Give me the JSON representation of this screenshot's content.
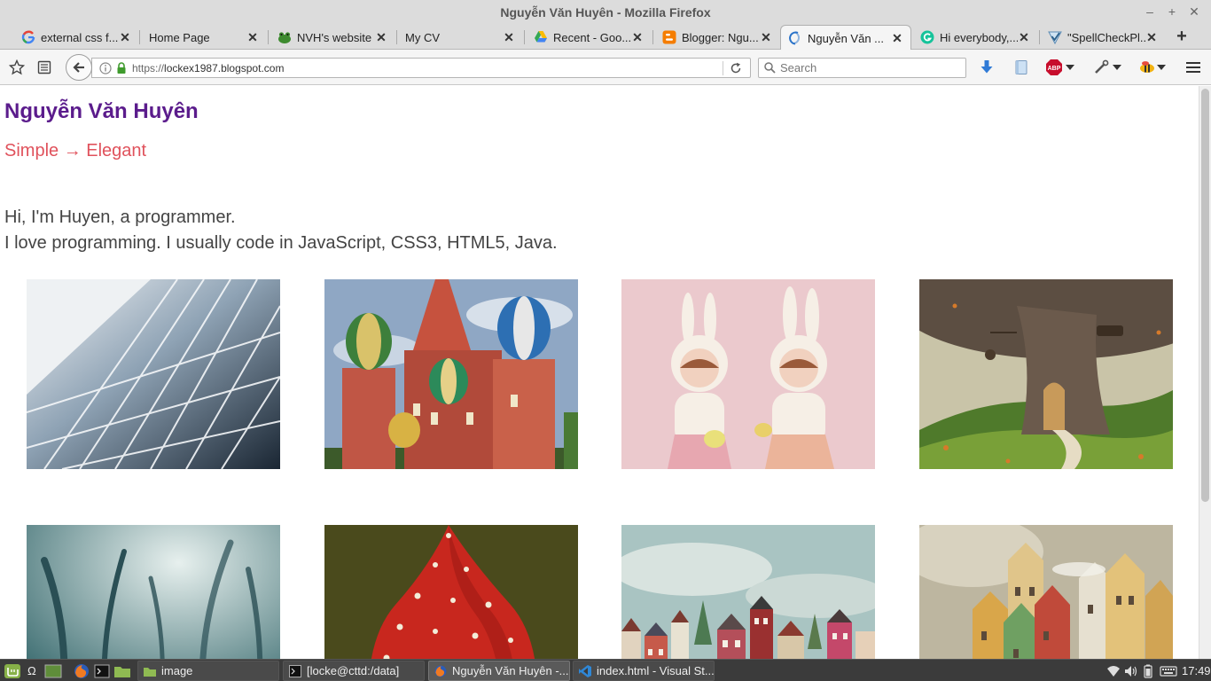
{
  "window": {
    "title": "Nguyễn Văn Huyên - Mozilla Firefox",
    "minimize_glyph": "–",
    "maximize_glyph": "+",
    "close_glyph": "✕"
  },
  "tabs": [
    {
      "label": "external css f...",
      "icon": "google-g-icon"
    },
    {
      "label": "Home Page",
      "icon": ""
    },
    {
      "label": "NVH's website",
      "icon": "frog-icon"
    },
    {
      "label": "My CV",
      "icon": ""
    },
    {
      "label": "Recent - Goo...",
      "icon": "google-drive-icon"
    },
    {
      "label": "Blogger: Ngu...",
      "icon": "blogger-icon"
    },
    {
      "label": "Nguyễn Văn ...",
      "icon": "spinner-icon",
      "active": true
    },
    {
      "label": "Hi everybody,...",
      "icon": "grammarly-icon"
    },
    {
      "label": "\"SpellCheckPl...",
      "icon": "spellcheck-icon"
    }
  ],
  "tab_close_glyph": "✕",
  "new_tab_glyph": "+",
  "nav": {
    "url_prefix": "https://",
    "url_host": "lockex1987.blogspot.com",
    "search_placeholder": "Search"
  },
  "page": {
    "title": "Nguyễn Văn Huyên",
    "tagline": "Simple → Elegant",
    "intro_line1": "Hi, I'm Huyen, a programmer.",
    "intro_line2": "I love programming. I usually code in JavaScript, CSS3, HTML5, Java."
  },
  "gallery": [
    {
      "subject": "glass-skyscraper"
    },
    {
      "subject": "st-basils-cathedral"
    },
    {
      "subject": "bunny-eared-dolls"
    },
    {
      "subject": "fairy-tree-house"
    },
    {
      "subject": "misty-forest"
    },
    {
      "subject": "red-mushroom"
    },
    {
      "subject": "painted-town"
    },
    {
      "subject": "tilted-houses"
    }
  ],
  "taskbar": {
    "omega": "Ω",
    "folder_label": "image",
    "terminal_label": "[locke@cttd:/data]",
    "firefox_label": "Nguyễn Văn Huyên -...",
    "vscode_label": "index.html - Visual St...",
    "clock": "17:49"
  },
  "colors": {
    "site_title": "#5b1c8c",
    "tagline": "#e0525c",
    "body_text": "#444444",
    "taskbar": "#3b3b3b"
  }
}
